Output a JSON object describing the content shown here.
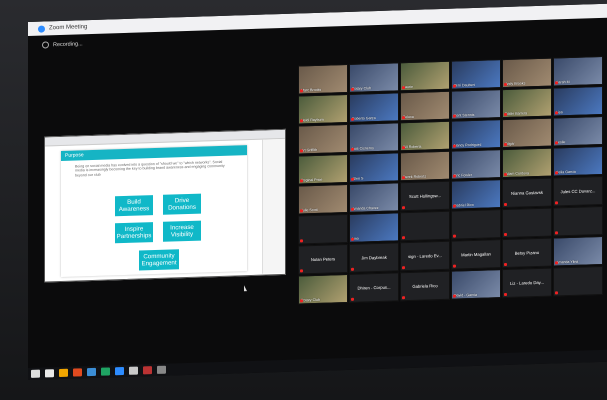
{
  "window": {
    "title": "Zoom Meeting",
    "recording_label": "Recording..."
  },
  "shared_doc": {
    "heading": "Purpose",
    "body": "Being on social media has evolved into a question of \"should we\" to \"which networks\". Social media is increasingly becoming the key to building brand awareness and engaging community beyond our club",
    "tiles": [
      {
        "label": "Build Awareness"
      },
      {
        "label": "Drive Donations"
      },
      {
        "label": "Inspire Partnerships"
      },
      {
        "label": "Increase Visibility"
      },
      {
        "label": "Community Engagement"
      }
    ]
  },
  "participants": [
    {
      "name": "Marc Brooks",
      "label": "",
      "video": true
    },
    {
      "name": "Rotary Club",
      "label": "",
      "video": true
    },
    {
      "name": "Laurie",
      "label": "",
      "video": true
    },
    {
      "name": "Terri Daubert",
      "label": "",
      "video": true
    },
    {
      "name": "Andy Brooks",
      "label": "",
      "video": true
    },
    {
      "name": "Sarah M",
      "label": "",
      "video": true
    },
    {
      "name": "Heidi Rayburn",
      "label": "",
      "video": true
    },
    {
      "name": "Roberto Garza",
      "label": "",
      "video": true
    },
    {
      "name": "Zeluca",
      "label": "",
      "video": true
    },
    {
      "name": "Kent Stennis",
      "label": "",
      "video": true
    },
    {
      "name": "Eddie Barrera",
      "label": "",
      "video": true
    },
    {
      "name": "Lisa",
      "label": "",
      "video": true
    },
    {
      "name": "Art Griffith",
      "label": "",
      "video": true
    },
    {
      "name": "Luis Cisneros",
      "label": "",
      "video": true
    },
    {
      "name": "Bill Roberts",
      "label": "",
      "video": true
    },
    {
      "name": "Nancy Rodriguez",
      "label": "",
      "video": true
    },
    {
      "name": "Edgar",
      "label": "",
      "video": true
    },
    {
      "name": "Leslie",
      "label": "",
      "video": true
    },
    {
      "name": "Reginal Price",
      "label": "",
      "video": true
    },
    {
      "name": "Allen S",
      "label": "",
      "video": true
    },
    {
      "name": "Derek Roberts",
      "label": "",
      "video": true
    },
    {
      "name": "Eric Fowler",
      "label": "",
      "video": true
    },
    {
      "name": "Adam Cordova",
      "label": "",
      "video": true
    },
    {
      "name": "Celia Garcia",
      "label": "",
      "video": true
    },
    {
      "name": "Julie Scott",
      "label": "",
      "video": true
    },
    {
      "name": "Amanda Chavez",
      "label": "",
      "video": true
    },
    {
      "name": "",
      "label": "Scott Hollingsw...",
      "video": false
    },
    {
      "name": "Gabriel Rico",
      "label": "",
      "video": true
    },
    {
      "name": "",
      "label": "Nianna Gustavsk",
      "video": false
    },
    {
      "name": "",
      "label": "Jules CC Duvarz...",
      "video": false
    },
    {
      "name": "",
      "label": "",
      "video": false
    },
    {
      "name": "Lino",
      "label": "",
      "video": true
    },
    {
      "name": "",
      "label": "",
      "video": false
    },
    {
      "name": "",
      "label": "",
      "video": false
    },
    {
      "name": "",
      "label": "",
      "video": false
    },
    {
      "name": "",
      "label": "",
      "video": false
    },
    {
      "name": "",
      "label": "Nolan Peters",
      "video": false
    },
    {
      "name": "",
      "label": "Jim Daybreak",
      "video": false
    },
    {
      "name": "",
      "label": "sign - Laredo Ev...",
      "video": false
    },
    {
      "name": "",
      "label": "Martin Magallan",
      "video": false
    },
    {
      "name": "",
      "label": "Betsy Pizano",
      "video": false
    },
    {
      "name": "Amanda Ylina",
      "label": "",
      "video": true
    },
    {
      "name": "Rotary Club",
      "label": "",
      "video": true
    },
    {
      "name": "",
      "label": "Dhiren - Corpus...",
      "video": false
    },
    {
      "name": "",
      "label": "Gabriela Rico",
      "video": false
    },
    {
      "name": "David - Garcia",
      "label": "",
      "video": true
    },
    {
      "name": "",
      "label": "Liz - Laredo Day...",
      "video": false
    },
    {
      "name": "",
      "label": "",
      "video": false
    }
  ],
  "colors": {
    "accent": "#16b4c4",
    "mute": "#e22222"
  }
}
